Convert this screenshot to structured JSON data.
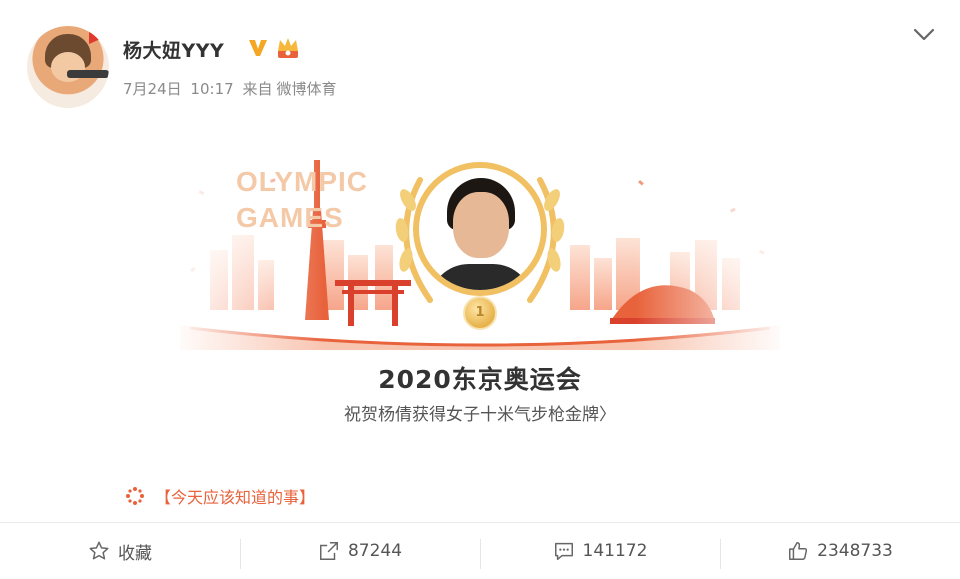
{
  "post": {
    "username": "杨大妞YYY",
    "date": "7月24日",
    "time": "10:17",
    "source_prefix": "来自",
    "source": "微博体育"
  },
  "card": {
    "banner_text_line1": "OLYMPIC",
    "banner_text_line2": "GAMES",
    "medal_label": "1",
    "title": "2020东京奥运会",
    "subtitle": "祝贺杨倩获得女子十米气步枪金牌〉"
  },
  "topic_link": {
    "label": "【今天应该知道的事】"
  },
  "actions": {
    "favorite_label": "收藏",
    "repost_count": "87244",
    "comment_count": "141172",
    "like_count": "2348733"
  },
  "colors": {
    "accent_orange": "#e8623b",
    "gold": "#f0c063",
    "verified": "#f5a623",
    "text_primary": "#333333",
    "text_secondary": "#8a8a8a"
  },
  "icons": {
    "verified": "verified-v-icon",
    "vip": "vip-crown-icon",
    "more": "chevron-down-icon",
    "topic": "sparkle-icon",
    "favorite": "star-icon",
    "repost": "share-icon",
    "comment": "comment-icon",
    "like": "thumbs-up-icon"
  }
}
